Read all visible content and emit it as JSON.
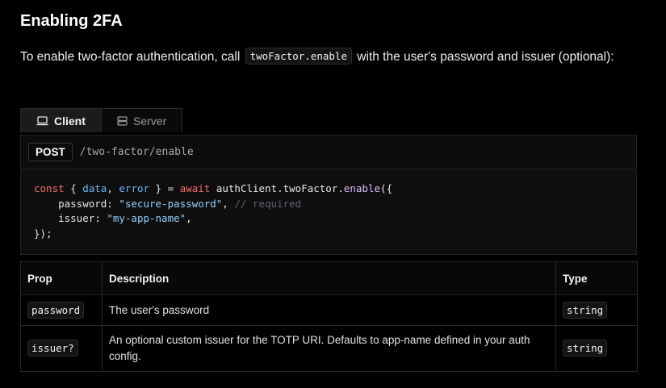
{
  "heading": "Enabling 2FA",
  "intro": {
    "before": "To enable two-factor authentication, call ",
    "code": "twoFactor.enable",
    "after": " with the user's password and issuer (optional):"
  },
  "tabs": [
    {
      "label": "Client",
      "icon": "laptop-icon",
      "active": true
    },
    {
      "label": "Server",
      "icon": "server-icon",
      "active": false
    }
  ],
  "endpoint": {
    "method": "POST",
    "path": "/two-factor/enable"
  },
  "code": {
    "line1": {
      "kw1": "const",
      "p1": " { ",
      "v1": "data",
      "p2": ", ",
      "v2": "error",
      "p3": " } = ",
      "kw2": "await",
      "p4": " authClient.twoFactor.",
      "fn": "enable",
      "p5": "({"
    },
    "line2": {
      "key": "    password: ",
      "str": "\"secure-password\"",
      "sep": ", ",
      "cmt": "// required"
    },
    "line3": {
      "key": "    issuer: ",
      "str": "\"my-app-name\"",
      "sep": ","
    },
    "line4": "});"
  },
  "table": {
    "headers": [
      "Prop",
      "Description",
      "Type"
    ],
    "rows": [
      {
        "prop": "password",
        "description": "The user's password",
        "type": "string"
      },
      {
        "prop": "issuer?",
        "description": "An optional custom issuer for the TOTP URI. Defaults to app-name defined in your auth config.",
        "type": "string"
      }
    ]
  },
  "colors": {
    "background": "#000000",
    "keyword": "#f47067",
    "variable": "#6cb6ff",
    "function": "#dcbdfb",
    "string": "#96d0ff",
    "comment": "#5c6370"
  }
}
